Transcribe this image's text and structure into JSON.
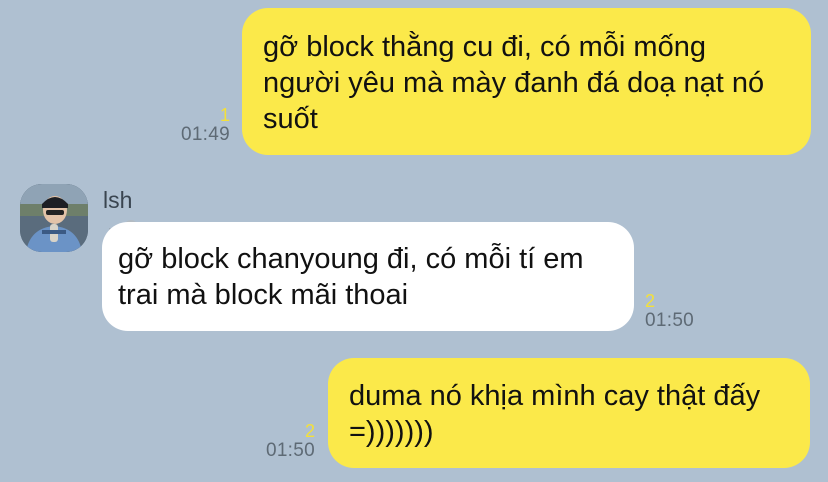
{
  "messages": [
    {
      "direction": "outgoing",
      "text": "gỡ block thằng cu đi, có mỗi mống người yêu mà mày đanh đá doạ nạt nó suốt",
      "read_count": "1",
      "time": "01:49"
    },
    {
      "direction": "incoming",
      "sender": "lsh",
      "sender_emoji": "seal-icon",
      "text": "gỡ block chanyoung đi, có mỗi tí em trai mà block mãi thoai",
      "read_count": "2",
      "time": "01:50"
    },
    {
      "direction": "outgoing",
      "text": "duma nó khịa mình cay thật đấy =)))))))",
      "read_count": "2",
      "time": "01:50"
    }
  ],
  "colors": {
    "background": "#AFC0D1",
    "outgoing_bubble": "#FBE94A",
    "incoming_bubble": "#FFFFFF",
    "read_count": "#F3E03A",
    "timestamp": "#5E6A75"
  }
}
